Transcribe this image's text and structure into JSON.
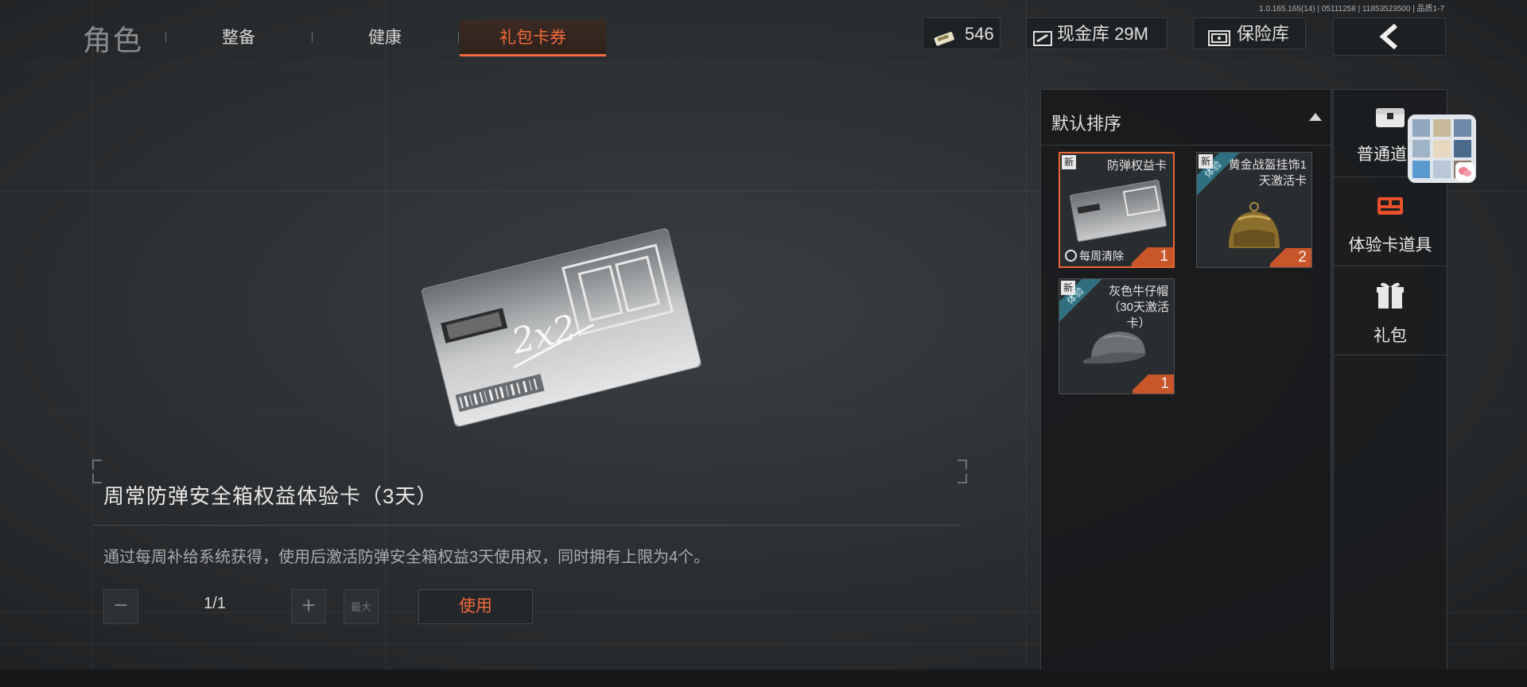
{
  "header": {
    "title": "角色",
    "tabs": [
      {
        "label": "整备",
        "active": false
      },
      {
        "label": "健康",
        "active": false
      },
      {
        "label": "礼包卡券",
        "active": true
      }
    ],
    "version": "1.0.165.165(14) | 05111258 | 11853523500 | 品质1-7",
    "currencies": {
      "tickets": "546",
      "cash_vault": "现金库 29M",
      "safe_vault": "保险库"
    }
  },
  "item_detail": {
    "card_text": "2x2",
    "name": "周常防弹安全箱权益体验卡（3天）",
    "description": "通过每周补给系统获得，使用后激活防弹安全箱权益3天使用权，同时拥有上限为4个。",
    "quantity": "1/1",
    "minus_label": "−",
    "plus_label": "+",
    "max_label": "最大",
    "use_label": "使用"
  },
  "inventory": {
    "sort_label": "默认排序",
    "items": [
      {
        "name": "防弹权益卡",
        "new_tag": "新",
        "trial_tag": "",
        "count": "1",
        "footer": "每周清除",
        "selected": true
      },
      {
        "name": "黄金战盔挂饰1\n天激活卡",
        "new_tag": "新",
        "trial_tag": "体验",
        "count": "2",
        "footer": "",
        "selected": false
      },
      {
        "name": "灰色牛仔帽\n（30天激活\n卡）",
        "new_tag": "新",
        "trial_tag": "体验",
        "count": "1",
        "footer": "",
        "selected": false
      }
    ]
  },
  "categories": [
    {
      "label": "普通道具",
      "icon": "chest-icon"
    },
    {
      "label": "体验卡道具",
      "icon": "trial-card-icon",
      "accent": "#e8502a"
    },
    {
      "label": "礼包",
      "icon": "gift-icon"
    }
  ],
  "colors": {
    "accent": "#f26a3a",
    "panel": "#16181a",
    "count_tag": "#c9552a",
    "trial_tag": "#2f6f7f"
  }
}
